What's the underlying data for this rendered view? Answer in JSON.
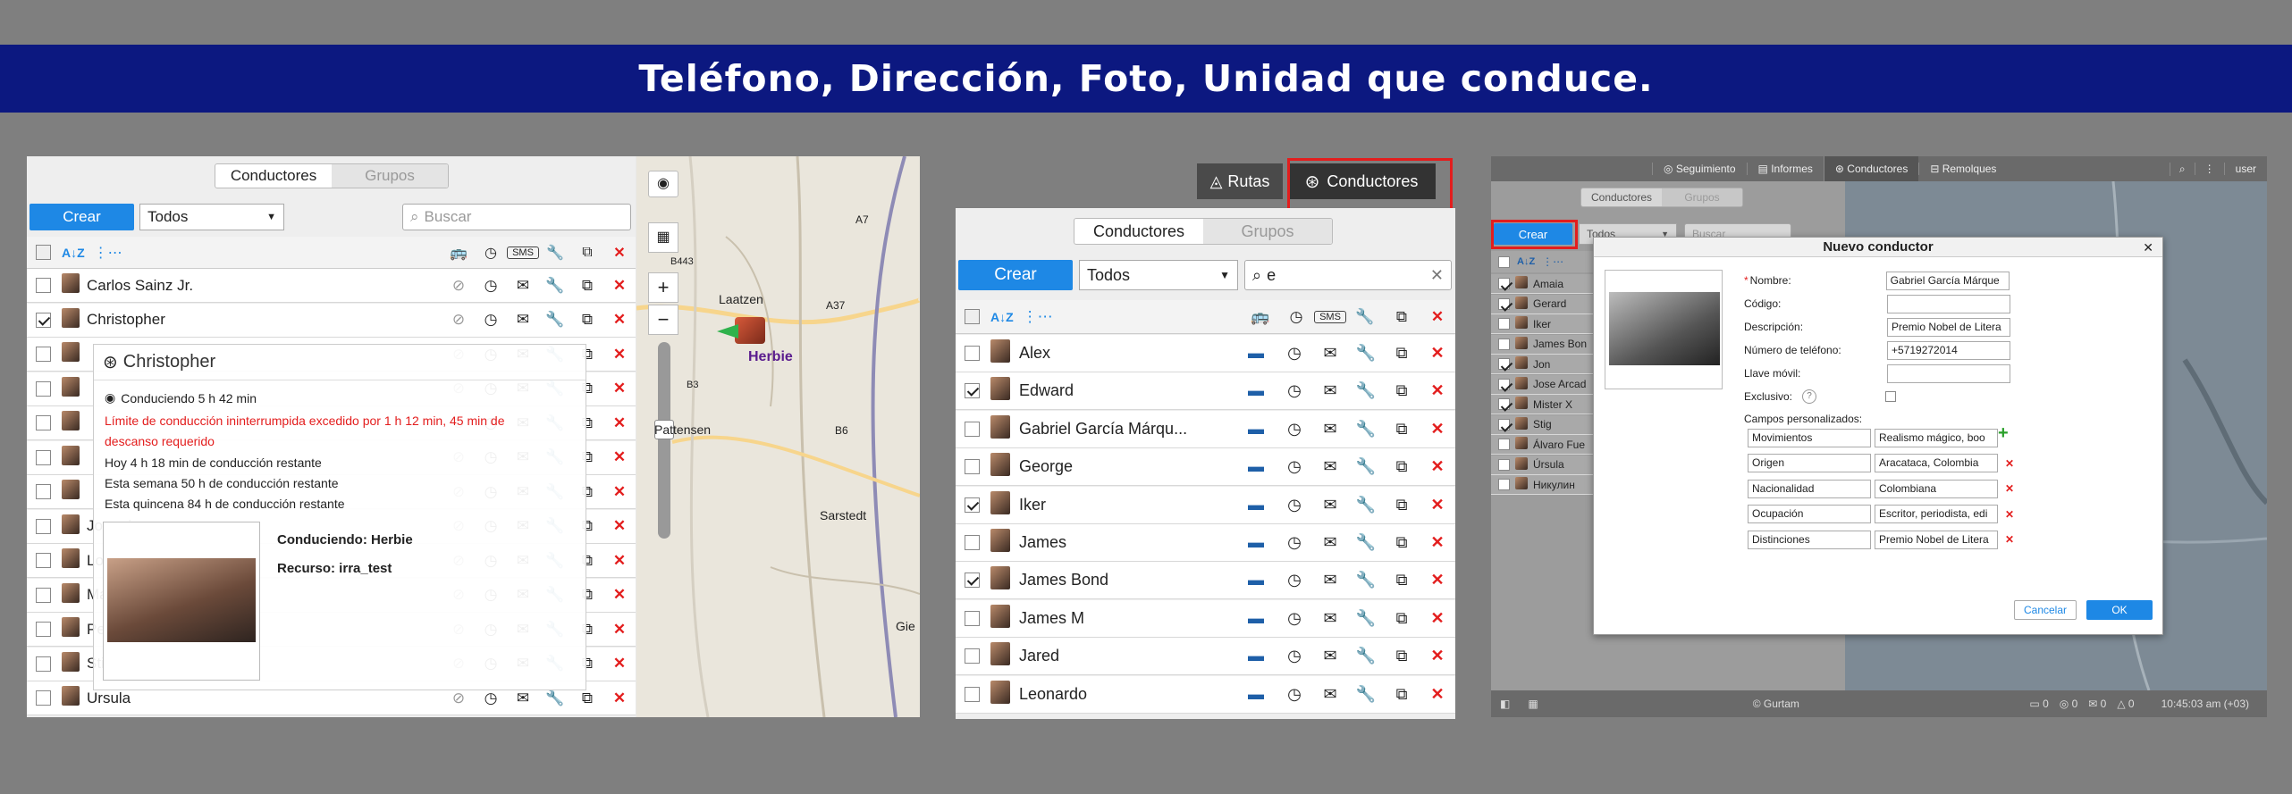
{
  "banner": {
    "title": "Teléfono, Dirección, Foto, Unidad que conduce."
  },
  "p1": {
    "tabs": [
      "Conductores",
      "Grupos"
    ],
    "create": "Crear",
    "filter": "Todos",
    "search_placeholder": "Buscar",
    "rows": [
      {
        "name": "Carlos Sainz Jr.",
        "checked": false
      },
      {
        "name": "Christopher",
        "checked": true
      },
      {
        "name": "",
        "checked": false
      },
      {
        "name": "",
        "checked": false
      },
      {
        "name": "",
        "checked": false
      },
      {
        "name": "",
        "checked": false
      },
      {
        "name": "",
        "checked": false
      },
      {
        "name": "Joaquin",
        "checked": false
      },
      {
        "name": "Lorenzo",
        "checked": false
      },
      {
        "name": "Marc Ge...",
        "checked": false
      },
      {
        "name": "Pedro",
        "checked": false
      },
      {
        "name": "Stig",
        "checked": false
      },
      {
        "name": "Ursula",
        "checked": false
      }
    ],
    "popup": {
      "title": "Christopher",
      "driving": "Conduciendo 5 h 42 min",
      "warning": "Límite de conducción ininterrumpida excedido por 1 h 12 min, 45 min de descanso requerido",
      "today": "Hoy 4 h 18 min de conducción restante",
      "week": "Esta semana 50 h de conducción restante",
      "fortnight": "Esta quincena 84 h de conducción restante",
      "unit": "Conduciendo: Herbie",
      "resource": "Recurso: irra_test"
    },
    "map": {
      "labels": [
        "Laatzen",
        "A37",
        "A7",
        "Pattensen",
        "B3",
        "B6",
        "Sarstedt",
        "Gie",
        "B443"
      ],
      "unit_label": "Herbie"
    }
  },
  "p2": {
    "header_tabs": [
      "Rutas",
      "Conductores"
    ],
    "tabs": [
      "Conductores",
      "Grupos"
    ],
    "create": "Crear",
    "filter": "Todos",
    "search_value": "e",
    "rows": [
      {
        "name": "Alex",
        "checked": false
      },
      {
        "name": "Edward",
        "checked": true
      },
      {
        "name": "Gabriel García Márqu...",
        "checked": false
      },
      {
        "name": "George",
        "checked": false
      },
      {
        "name": "Iker",
        "checked": true
      },
      {
        "name": "James",
        "checked": false
      },
      {
        "name": "James Bond",
        "checked": true
      },
      {
        "name": "James M",
        "checked": false
      },
      {
        "name": "Jared",
        "checked": false
      },
      {
        "name": "Leonardo",
        "checked": false
      }
    ]
  },
  "p3": {
    "nav": [
      "Seguimiento",
      "Informes",
      "Conductores",
      "Remolques"
    ],
    "user": "user",
    "tabs": [
      "Conductores",
      "Grupos"
    ],
    "create": "Crear",
    "filter": "Todos",
    "search_placeholder": "Buscar",
    "rows": [
      {
        "name": "Amaia",
        "checked": true
      },
      {
        "name": "Gerard",
        "checked": true
      },
      {
        "name": "Iker",
        "checked": false
      },
      {
        "name": "James Bon",
        "checked": false
      },
      {
        "name": "Jon",
        "checked": true
      },
      {
        "name": "Jose Arcad",
        "checked": true
      },
      {
        "name": "Mister X",
        "checked": true
      },
      {
        "name": "Stig",
        "checked": true
      },
      {
        "name": "Álvaro Fue",
        "checked": false
      },
      {
        "name": "Úrsula",
        "checked": false
      },
      {
        "name": "Никулин",
        "checked": false
      }
    ],
    "dialog": {
      "title": "Nuevo conductor",
      "name_label": "Nombre:",
      "name_value": "Gabriel García Márque",
      "code_label": "Código:",
      "desc_label": "Descripción:",
      "desc_value": "Premio Nobel de Litera",
      "phone_label": "Número de teléfono:",
      "phone_value": "+5719272014",
      "key_label": "Llave móvil:",
      "exclusive_label": "Exclusivo:",
      "custom_label": "Campos personalizados:",
      "custom": [
        {
          "k": "Movimientos",
          "v": "Realismo mágico, boo"
        },
        {
          "k": "Origen",
          "v": "Aracataca, Colombia"
        },
        {
          "k": "Nacionalidad",
          "v": "Colombiana"
        },
        {
          "k": "Ocupación",
          "v": "Escritor, periodista, edi"
        },
        {
          "k": "Distinciones",
          "v": "Premio Nobel de Litera"
        }
      ],
      "cancel": "Cancelar",
      "ok": "OK"
    },
    "footer": {
      "copyright": "© Gurtam",
      "time": "10:45:03 am (+03)",
      "counts": [
        "0",
        "0",
        "0",
        "0"
      ]
    }
  },
  "colors": {
    "accent": "#1e88e5",
    "banner": "#0c1880",
    "danger": "#e31d1d",
    "highlight": "#e31d1d"
  }
}
